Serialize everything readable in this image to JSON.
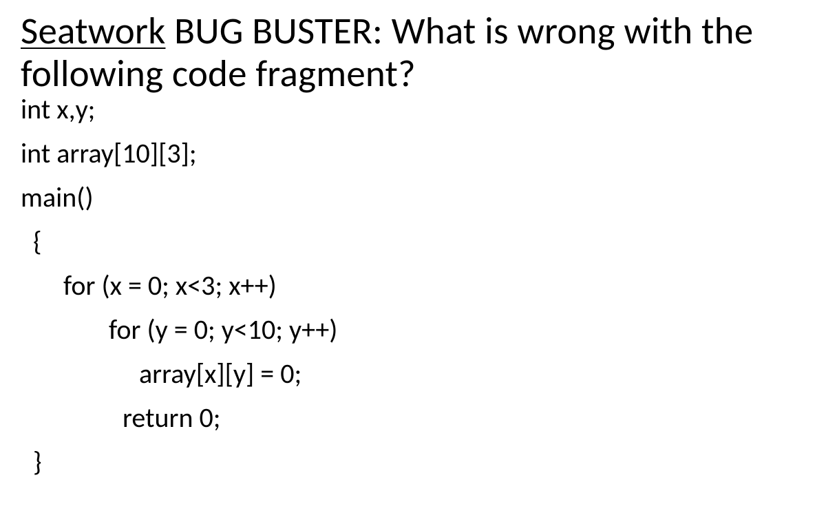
{
  "title": {
    "seatwork": "Seatwork",
    "rest": " BUG BUSTER: What is wrong with the following code fragment?"
  },
  "code": {
    "line1": "int x,y;",
    "line2": "int array[10][3];",
    "line3": "main()",
    "line4": "{",
    "line5": "for (x = 0; x<3; x++)",
    "line6": "for (y = 0; y<10; y++)",
    "line7": "array[x][y] = 0;",
    "line8": "return 0;",
    "line9": "}"
  }
}
